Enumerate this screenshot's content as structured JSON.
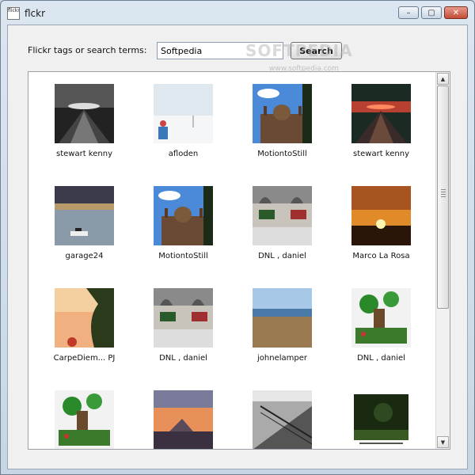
{
  "window": {
    "title": "flckr",
    "icon_text": "flickr",
    "buttons": {
      "minimize": "–",
      "maximize": "▢",
      "close": "✕"
    }
  },
  "search": {
    "label": "Flickr tags or search terms:",
    "value": "Softpedia",
    "button_label": "Search"
  },
  "watermark": {
    "text": "SOFTPEDIA",
    "url": "www.softpedia.com"
  },
  "photos": [
    {
      "author": "stewart kenny",
      "scene": "pier-bw"
    },
    {
      "author": "afloden",
      "scene": "snow-person"
    },
    {
      "author": "MotiontoStill",
      "scene": "domed-building"
    },
    {
      "author": "stewart kenny",
      "scene": "pier-red"
    },
    {
      "author": "garage24",
      "scene": "river-boat"
    },
    {
      "author": "MotiontoStill",
      "scene": "domed-building"
    },
    {
      "author": "DNL , daniel",
      "scene": "lego-room"
    },
    {
      "author": "Marco La Rosa",
      "scene": "sunset-sun"
    },
    {
      "author": "CarpeDiem... PJ",
      "scene": "tree-sunset"
    },
    {
      "author": "DNL , daniel",
      "scene": "lego-room"
    },
    {
      "author": "johnelamper",
      "scene": "coast"
    },
    {
      "author": "DNL , daniel",
      "scene": "lego-tree"
    },
    {
      "author": "",
      "scene": "lego-tree"
    },
    {
      "author": "",
      "scene": "dusk-mountain"
    },
    {
      "author": "",
      "scene": "fence-bw"
    },
    {
      "author": "",
      "scene": "dark-garden"
    }
  ],
  "scrollbar": {
    "up_arrow": "▲",
    "down_arrow": "▼"
  },
  "colors": {
    "window_bg": "#f0f0f0",
    "close_button": "#c24b35",
    "gallery_bg": "#ffffff"
  }
}
